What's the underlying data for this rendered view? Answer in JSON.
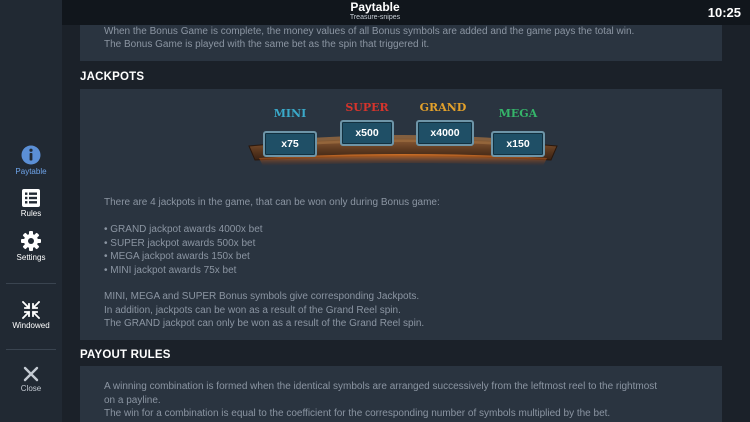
{
  "header": {
    "title": "Paytable",
    "subtitle": "Treasure-snipes",
    "clock": "10:25"
  },
  "sidebar": {
    "items": [
      {
        "label": "Paytable",
        "icon": "info-icon",
        "active": true
      },
      {
        "label": "Rules",
        "icon": "list-icon"
      },
      {
        "label": "Settings",
        "icon": "gear-icon"
      },
      {
        "label": "Windowed",
        "icon": "collapse-arrows-icon"
      },
      {
        "label": "Close",
        "icon": "close-icon"
      }
    ]
  },
  "bonus": {
    "lines": [
      "When the Bonus Game is complete, the money values of all Bonus symbols are added and the game pays the total win.",
      "The Bonus Game is played with the same bet as the spin that triggered it."
    ]
  },
  "jackpots": {
    "heading": "JACKPOTS",
    "tiers": [
      {
        "name": "MINI",
        "value": "x75",
        "color": "#3aa9c9"
      },
      {
        "name": "SUPER",
        "value": "x500",
        "color": "#d6342c"
      },
      {
        "name": "GRAND",
        "value": "x4000",
        "color": "#e3a12b"
      },
      {
        "name": "MEGA",
        "value": "x150",
        "color": "#35b56a"
      }
    ],
    "intro": "There are 4 jackpots in the game, that can be won only during Bonus game:",
    "bullets": [
      "• GRAND jackpot awards 4000x bet",
      "• SUPER jackpot awards 500x bet",
      "• MEGA jackpot awards 150x bet",
      "• MINI jackpot awards 75x bet"
    ],
    "notes": [
      "MINI, MEGA and SUPER Bonus symbols give corresponding Jackpots.",
      "In addition, jackpots can be won as a result of the Grand Reel spin.",
      "The GRAND jackpot can only be won as a result of the Grand Reel spin."
    ]
  },
  "payout": {
    "heading": "PAYOUT RULES",
    "lines": [
      "A winning combination is formed when the identical symbols are arranged successively from the leftmost reel to the rightmost",
      "on a payline.",
      "The win for a combination is equal to the coefficient for the corresponding number of symbols multiplied by the bet."
    ]
  }
}
